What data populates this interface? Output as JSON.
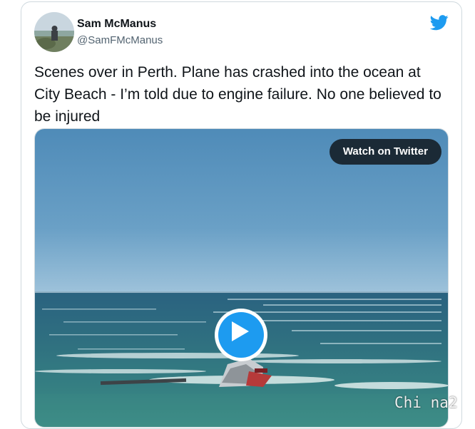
{
  "tweet": {
    "author_name": "Sam McManus",
    "author_handle": "@SamFMcManus",
    "text": "Scenes over in Perth. Plane has crashed into the ocean at City Beach - I’m told due to engine failure. No one believed to be injured"
  },
  "media": {
    "watch_label": "Watch on Twitter",
    "play_icon": "play-icon"
  },
  "icons": {
    "brand": "twitter-bird-icon",
    "avatar": "avatar-photo"
  },
  "watermark": "Chi na2",
  "colors": {
    "twitter_blue": "#1d9bf0",
    "text": "#0f1419",
    "secondary_text": "#536471",
    "border": "#cfd9de",
    "sky": "#5d95bf",
    "ocean": "#2f6e7d",
    "shallow_water": "#3f8f86"
  }
}
